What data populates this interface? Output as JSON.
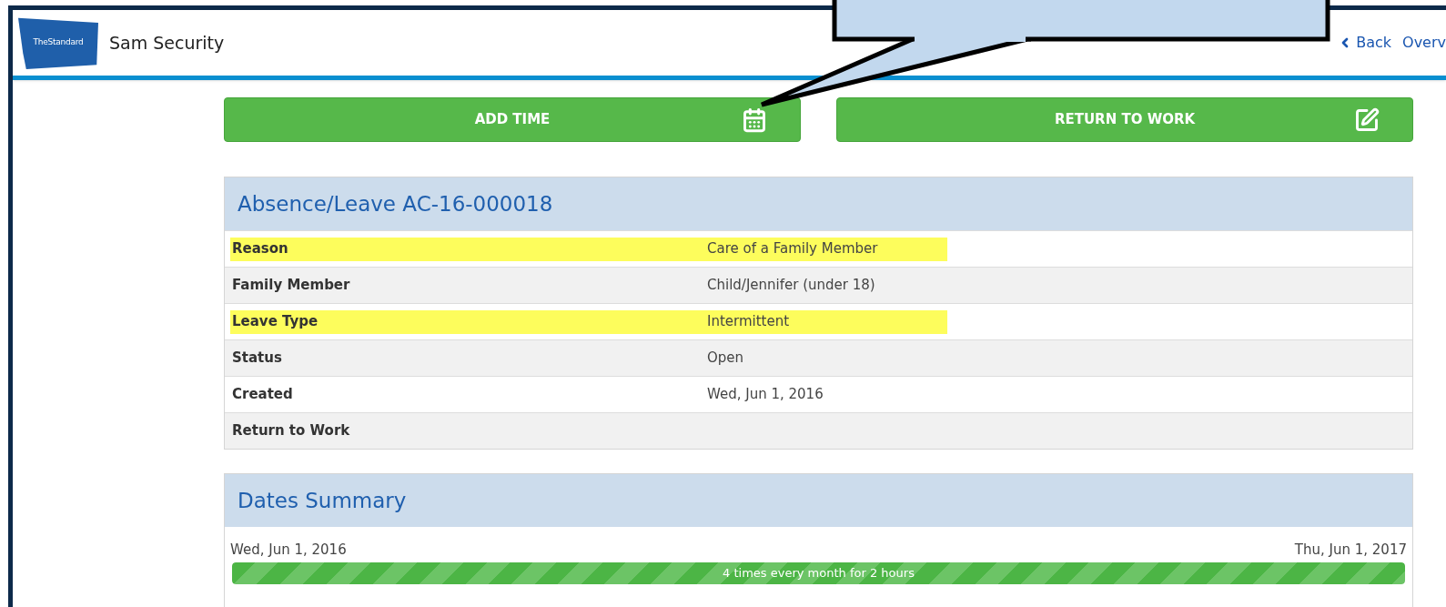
{
  "header": {
    "logo_text": "TheStandard",
    "user_name": "Sam Security",
    "nav_links": [
      {
        "label": "Back",
        "kind": "back"
      },
      {
        "label": "Overv",
        "kind": "plain"
      }
    ]
  },
  "actions": [
    {
      "label": "ADD TIME",
      "kind": "add"
    },
    {
      "label": "RETURN TO WORK",
      "kind": "return"
    }
  ],
  "absence": {
    "title": "Absence/Leave AC-16-000018",
    "rows": [
      {
        "label": "Reason",
        "value": "Care of a Family Member",
        "highlighted": true
      },
      {
        "label": "Family Member",
        "value": "Child/Jennifer (under 18)",
        "highlighted": false
      },
      {
        "label": "Leave Type",
        "value": "Intermittent",
        "highlighted": true
      },
      {
        "label": "Status",
        "value": "Open",
        "highlighted": false
      },
      {
        "label": "Created",
        "value": "Wed, Jun 1, 2016",
        "highlighted": false
      },
      {
        "label": "Return to Work",
        "highlighted": false
      }
    ]
  },
  "dates_summary": {
    "title": "Dates Summary",
    "start": "Wed, Jun 1, 2016",
    "end": "Thu, Jun 1, 2017",
    "bar": {
      "label": "4 times every month for 2 hours",
      "level": 1
    }
  }
}
